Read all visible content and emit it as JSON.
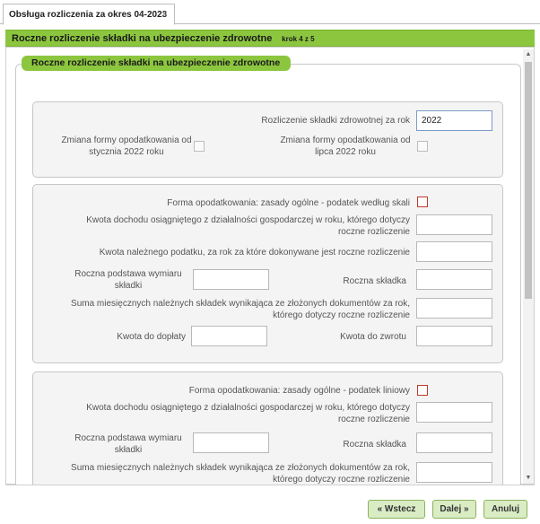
{
  "tab": {
    "title": "Obsługa rozliczenia za okres 04-2023",
    "close": "×"
  },
  "wizard": {
    "title": "Roczne rozliczenie składki na ubezpieczenie zdrowotne",
    "step": "krok 4 z 5"
  },
  "group": {
    "legend": "Roczne rozliczenie składki na ubezpieczenie zdrowotne"
  },
  "panel1": {
    "year_label": "Rozliczenie składki zdrowotnej za rok",
    "year_value": "2022",
    "change_jan_label": "Zmiana formy opodatkowania od stycznia 2022 roku",
    "change_jul_label": "Zmiana formy opodatkowania od lipca 2022 roku"
  },
  "panel2": {
    "form_label": "Forma opodatkowania: zasady ogólne - podatek według skali",
    "income_label": "Kwota dochodu osiągniętego z działalności gospodarczej w roku, którego dotyczy roczne rozliczenie",
    "tax_label": "Kwota należnego podatku, za rok za które dokonywane jest roczne rozliczenie",
    "base_label": "Roczna podstawa wymiaru składki",
    "annual_contribution_label": "Roczna składka",
    "sum_label": "Suma miesięcznych należnych składek wynikająca ze złożonych dokumentów za rok, którego dotyczy roczne rozliczenie",
    "to_pay_label": "Kwota do dopłaty",
    "to_refund_label": "Kwota do zwrotu"
  },
  "panel3": {
    "form_label": "Forma opodatkowania: zasady ogólne - podatek liniowy",
    "income_label": "Kwota dochodu osiągniętego z działalności gospodarczej w roku, którego dotyczy roczne rozliczenie",
    "base_label": "Roczna podstawa wymiaru składki",
    "annual_contribution_label": "Roczna składka",
    "sum_label": "Suma miesięcznych należnych składek wynikająca ze złożonych dokumentów za rok, którego dotyczy roczne rozliczenie"
  },
  "buttons": {
    "back": "« Wstecz",
    "next": "Dalej »",
    "cancel": "Anuluj"
  },
  "colors": {
    "accent": "#8cc63f",
    "required_border": "#c0392b"
  }
}
